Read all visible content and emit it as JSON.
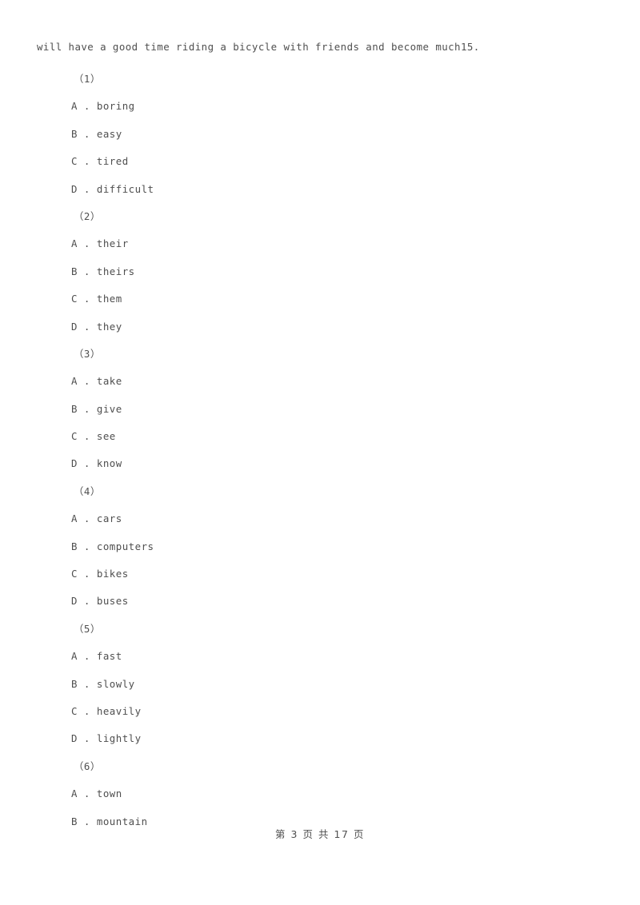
{
  "document": {
    "passage_line": "will have a good time riding a bicycle with friends and become much15.",
    "footer": "第 3 页 共 17 页"
  },
  "questions": [
    {
      "number": "（1）",
      "options": [
        {
          "label": "A .",
          "text": "boring"
        },
        {
          "label": "B .",
          "text": "easy"
        },
        {
          "label": "C .",
          "text": "tired"
        },
        {
          "label": "D .",
          "text": "difficult"
        }
      ]
    },
    {
      "number": "（2）",
      "options": [
        {
          "label": "A .",
          "text": "their"
        },
        {
          "label": "B .",
          "text": "theirs"
        },
        {
          "label": "C .",
          "text": "them"
        },
        {
          "label": "D .",
          "text": "they"
        }
      ]
    },
    {
      "number": "（3）",
      "options": [
        {
          "label": "A .",
          "text": "take"
        },
        {
          "label": "B .",
          "text": "give"
        },
        {
          "label": "C .",
          "text": "see"
        },
        {
          "label": "D .",
          "text": "know"
        }
      ]
    },
    {
      "number": "（4）",
      "options": [
        {
          "label": "A .",
          "text": "cars"
        },
        {
          "label": "B .",
          "text": "computers"
        },
        {
          "label": "C .",
          "text": "bikes"
        },
        {
          "label": "D .",
          "text": "buses"
        }
      ]
    },
    {
      "number": "（5）",
      "options": [
        {
          "label": "A .",
          "text": "fast"
        },
        {
          "label": "B .",
          "text": "slowly"
        },
        {
          "label": "C .",
          "text": "heavily"
        },
        {
          "label": "D .",
          "text": "lightly"
        }
      ]
    },
    {
      "number": "（6）",
      "options": [
        {
          "label": "A .",
          "text": "town"
        },
        {
          "label": "B .",
          "text": "mountain"
        }
      ]
    }
  ]
}
